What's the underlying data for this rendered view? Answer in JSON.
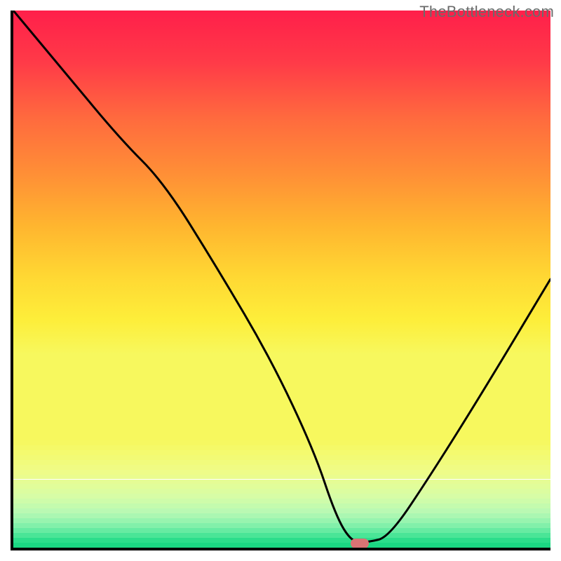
{
  "watermark": "TheBottleneck.com",
  "chart_data": {
    "type": "line",
    "title": "",
    "xlabel": "",
    "ylabel": "",
    "xlim": [
      0,
      100
    ],
    "ylim": [
      0,
      100
    ],
    "grid": false,
    "legend": false,
    "x": [
      0,
      10,
      20,
      28,
      38,
      48,
      56,
      60,
      63,
      66,
      70,
      78,
      88,
      100
    ],
    "y": [
      100,
      88,
      76,
      68,
      52,
      35,
      18,
      6,
      1,
      1,
      2,
      14,
      30,
      50
    ],
    "marker": {
      "x": 64.5,
      "y": 0.8
    },
    "gradient_stops": [
      {
        "pos": 0.0,
        "color": "#ff1f4a"
      },
      {
        "pos": 0.12,
        "color": "#ff3a48"
      },
      {
        "pos": 0.25,
        "color": "#ff6a3e"
      },
      {
        "pos": 0.38,
        "color": "#ff8f36"
      },
      {
        "pos": 0.5,
        "color": "#ffb52f"
      },
      {
        "pos": 0.62,
        "color": "#ffd833"
      },
      {
        "pos": 0.72,
        "color": "#fdee3a"
      },
      {
        "pos": 0.8,
        "color": "#f7f85e"
      },
      {
        "pos": 0.86,
        "color": "#eefc8a"
      },
      {
        "pos": 0.905,
        "color": "#d7fda6"
      },
      {
        "pos": 0.935,
        "color": "#b7f9b4"
      },
      {
        "pos": 0.955,
        "color": "#8ef2ae"
      },
      {
        "pos": 0.972,
        "color": "#5ce99e"
      },
      {
        "pos": 0.985,
        "color": "#2fde8c"
      },
      {
        "pos": 1.0,
        "color": "#12d47f"
      }
    ]
  }
}
